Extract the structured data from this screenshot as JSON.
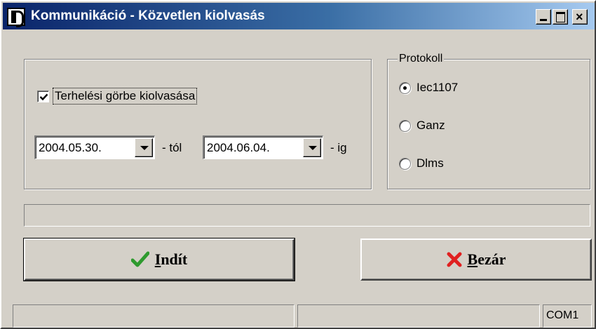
{
  "window": {
    "title": "Kommunikáció - Közvetlen kiolvasás",
    "controls": {
      "minimize": "_",
      "maximize": "□",
      "close": "×"
    }
  },
  "options": {
    "load_curve": {
      "label": "Terhelési görbe kiolvasása",
      "checked": true
    },
    "date_from": {
      "value": "2004.05.30.",
      "suffix": "- tól"
    },
    "date_to": {
      "value": "2004.06.04.",
      "suffix": "- ig"
    }
  },
  "protocol": {
    "legend": "Protokoll",
    "selected": "Iec1107",
    "options": [
      "Iec1107",
      "Ganz",
      "Dlms"
    ]
  },
  "progress": {
    "fraction": 0.0
  },
  "buttons": {
    "start": {
      "accel": "I",
      "rest": "ndít",
      "icon": "checkmark-icon"
    },
    "close": {
      "accel": "B",
      "rest": "ezár",
      "icon": "red-x-icon"
    }
  },
  "statusbar": {
    "panel1": "",
    "panel2": "",
    "port": "COM1"
  },
  "colors": {
    "titlebar_start": "#0a246a",
    "titlebar_end": "#a6caf0",
    "face": "#d4d0c8",
    "check_green": "#2e9a2e",
    "close_red": "#e02020"
  }
}
